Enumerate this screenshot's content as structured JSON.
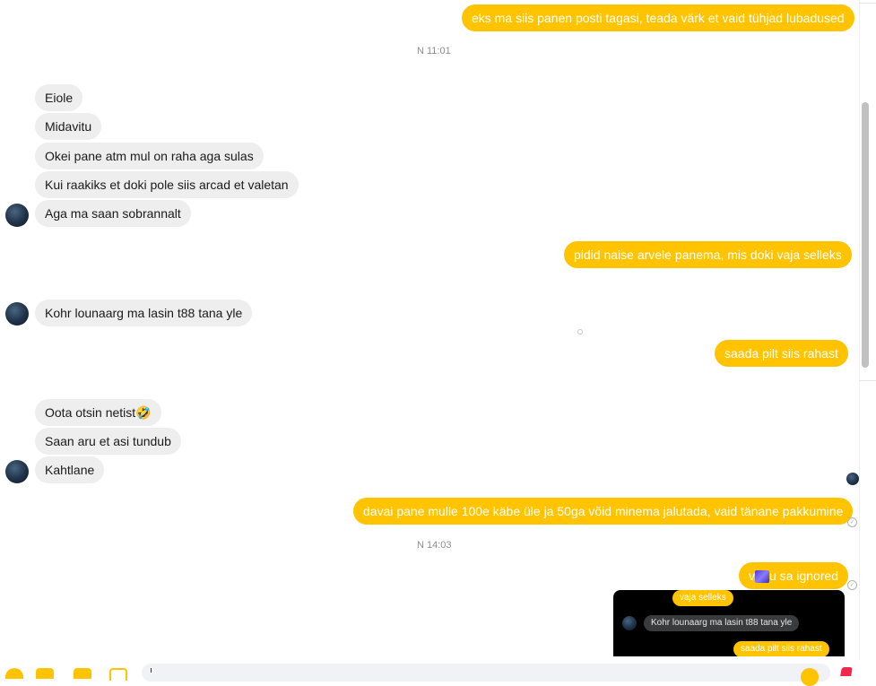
{
  "messages": {
    "m1": "eks ma siis panen posti tagasi, teada värk et vaid tühjad lubadused",
    "ts1": "N 11:01",
    "m2": "Eiole",
    "m3": "Midavitu",
    "m4": "Okei pane atm mul on raha aga sulas",
    "m5": "Kui raakiks et doki pole siis arcad et valetan",
    "m6": "Aga ma saan sobrannalt",
    "m7": "pidid naise arvele panema, mis doki vaja selleks",
    "m8": "Kohr lounaarg ma lasin t88 tana yle",
    "m9": "saada pilt siis rahast",
    "m10": "Oota otsin netist🤣",
    "m11": "Saan aru et asi tundub",
    "m12": "Kahtlane",
    "m13": "davai pane mulle 100e käbe üle ja 50ga võid minema jalutada, vaid tänane pakkumine",
    "ts2": "N 14:03",
    "m14_prefix": "v",
    "m14_suffix": "u sa ignored"
  },
  "preview": {
    "p1": "vaja selleks",
    "p2": "Kohr lounaarg ma lasin t88 tana yle",
    "p3": "saada pilt siis rahast"
  },
  "colors": {
    "outgoing": "#ffc300",
    "incoming": "#eeeeee",
    "timestamp": "#8a8d91"
  }
}
